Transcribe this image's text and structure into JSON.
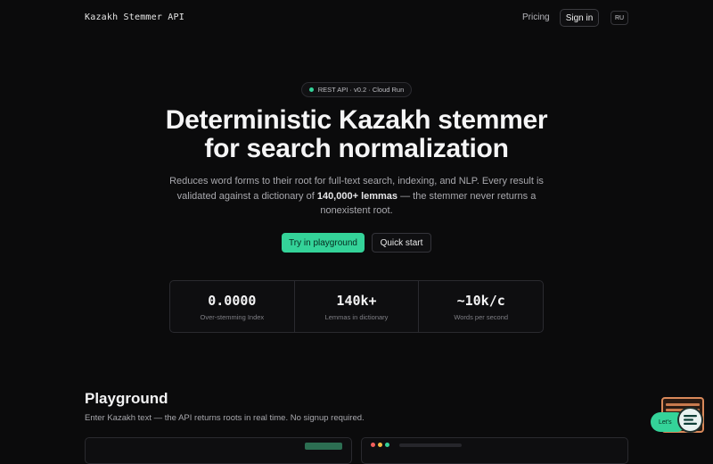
{
  "header": {
    "brand": "Kazakh Stemmer API",
    "nav_pricing": "Pricing",
    "signin_label": "Sign in",
    "lang_label": "RU"
  },
  "hero": {
    "badge_text": "REST API · v0.2 · Cloud Run",
    "title_line1": "Deterministic Kazakh stemmer",
    "title_line2": "for search normalization",
    "desc_before": "Reduces word forms to their root for full-text search, indexing, and NLP. Every result is validated against a dictionary of ",
    "desc_bold": "140,000+ lemmas",
    "desc_after": " — the stemmer never returns a nonexistent root.",
    "primary_cta": "Try in playground",
    "secondary_cta": "Quick start"
  },
  "stats": [
    {
      "value": "0.0000",
      "label": "Over-stemming Index"
    },
    {
      "value": "140k+",
      "label": "Lemmas in dictionary"
    },
    {
      "value": "~10k/c",
      "label": "Words per second"
    }
  ],
  "playground": {
    "title": "Playground",
    "description": "Enter Kazakh text — the API returns roots in real time. No signup required."
  },
  "widget": {
    "pill_text": "Let's"
  },
  "colors": {
    "accent": "#34d399",
    "background": "#0b0b0c",
    "widget_orange": "#d9895a",
    "dot_red": "#f25f5c",
    "dot_yellow": "#f5b942",
    "dot_green": "#34d399"
  },
  "icons": {
    "badge_dot": "status-dot-icon",
    "chat": "chat-lines-icon"
  }
}
